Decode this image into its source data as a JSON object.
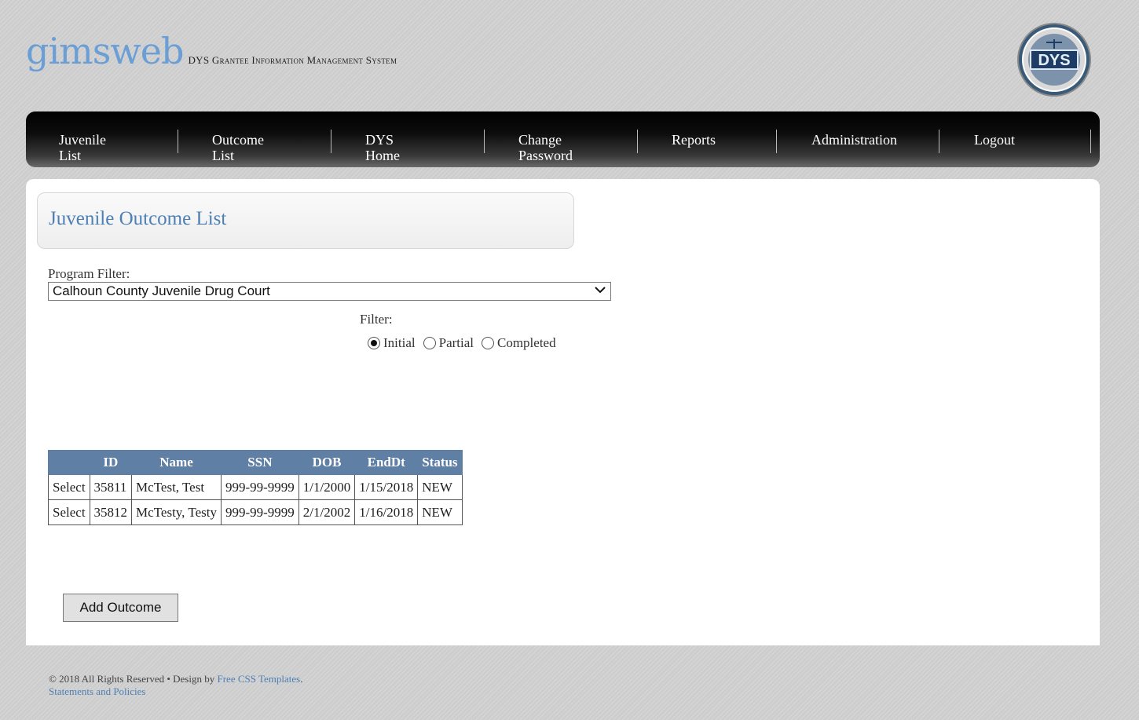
{
  "header": {
    "logo_gims": "gims",
    "logo_web": "web",
    "tagline": "DYS Grantee Information Management System",
    "seal_text": "DYS"
  },
  "nav": {
    "items": [
      {
        "label": "Juvenile List"
      },
      {
        "label": "Outcome List"
      },
      {
        "label": "DYS Home"
      },
      {
        "label": "Change Password"
      },
      {
        "label": "Reports"
      },
      {
        "label": "Administration"
      },
      {
        "label": "Logout"
      }
    ]
  },
  "page": {
    "title": "Juvenile Outcome List",
    "program_filter_label": "Program Filter:",
    "program_filter_value": "Calhoun County Juvenile Drug Court",
    "filter_label": "Filter:",
    "filter_options": [
      {
        "label": "Initial",
        "checked": true
      },
      {
        "label": "Partial",
        "checked": false
      },
      {
        "label": "Completed",
        "checked": false
      }
    ]
  },
  "table": {
    "headers": [
      "",
      "ID",
      "Name",
      "SSN",
      "DOB",
      "EndDt",
      "Status"
    ],
    "rows": [
      {
        "action": "Select",
        "id": "35811",
        "name": "McTest, Test",
        "ssn": "999-99-9999",
        "dob": "1/1/2000",
        "enddt": "1/15/2018",
        "status": "NEW"
      },
      {
        "action": "Select",
        "id": "35812",
        "name": "McTesty, Testy",
        "ssn": "999-99-9999",
        "dob": "2/1/2002",
        "enddt": "1/16/2018",
        "status": "NEW"
      }
    ]
  },
  "actions": {
    "add_outcome": "Add Outcome"
  },
  "footer": {
    "copyright": "© 2018 All Rights Reserved • Design by",
    "design_link": "Free CSS Templates",
    "period": ".",
    "policies_link": "Statements and Policies"
  },
  "colors": {
    "accent": "#4d7fb5",
    "table_header": "#5f7fa5",
    "nav_bg": "#000000"
  }
}
